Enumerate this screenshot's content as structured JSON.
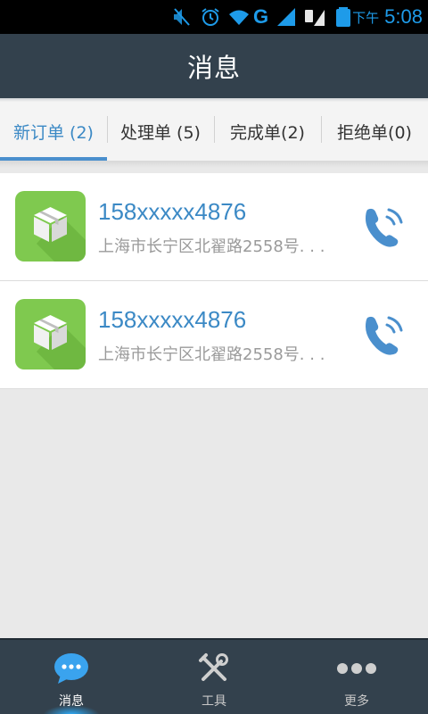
{
  "status_bar": {
    "network_label": "G",
    "ampm": "下午",
    "time": "5:08",
    "icons": [
      "mute-icon",
      "alarm-icon",
      "wifi-icon",
      "cell-signal-icon",
      "sim-signal-icon",
      "battery-icon"
    ],
    "color": "#1e9be9"
  },
  "header": {
    "title": "消息"
  },
  "tabs": [
    {
      "label": "新订单 (2)",
      "active": true
    },
    {
      "label": "处理单 (5)",
      "active": false
    },
    {
      "label": "完成单(2)",
      "active": false
    },
    {
      "label": "拒绝单(0)",
      "active": false
    }
  ],
  "orders": [
    {
      "phone": "158xxxxx4876",
      "address": "上海市长宁区北翟路2558号. . .",
      "icon": "package-icon",
      "action_icon": "phone-call-icon"
    },
    {
      "phone": "158xxxxx4876",
      "address": "上海市长宁区北翟路2558号. . .",
      "icon": "package-icon",
      "action_icon": "phone-call-icon"
    }
  ],
  "bottom_nav": [
    {
      "label": "消息",
      "icon": "chat-bubble-icon",
      "active": true
    },
    {
      "label": "工具",
      "icon": "tools-icon",
      "active": false
    },
    {
      "label": "更多",
      "icon": "more-dots-icon",
      "active": false
    }
  ],
  "colors": {
    "accent": "#3b89c5",
    "header_bg": "#33414d",
    "package_green": "#7fc94f"
  }
}
